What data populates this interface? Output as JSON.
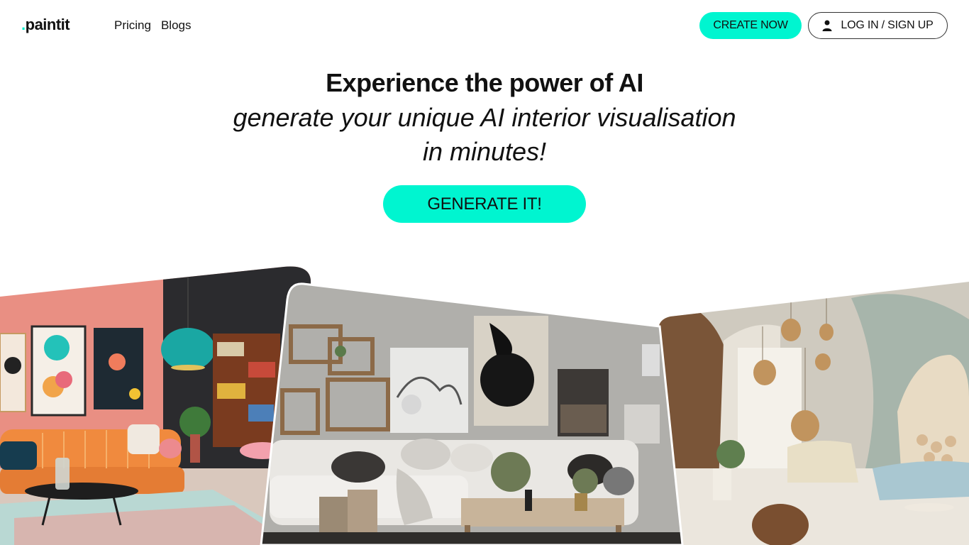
{
  "header": {
    "logo_text": "paintit",
    "nav": [
      {
        "label": "Pricing"
      },
      {
        "label": "Blogs"
      }
    ],
    "create_label": "CREATE NOW",
    "login_label": "LOG IN / SIGN UP"
  },
  "hero": {
    "title": "Experience the power of AI",
    "subtitle_line1": "generate your unique AI interior visualisation",
    "subtitle_line2": "in minutes!",
    "cta_label": "GENERATE IT!"
  },
  "colors": {
    "accent": "#00f5d0",
    "text": "#111111",
    "background": "#ffffff"
  },
  "gallery": {
    "images": [
      "pink-retro-living-room",
      "grey-gallery-wall-living-room",
      "organic-arched-living-room"
    ]
  }
}
